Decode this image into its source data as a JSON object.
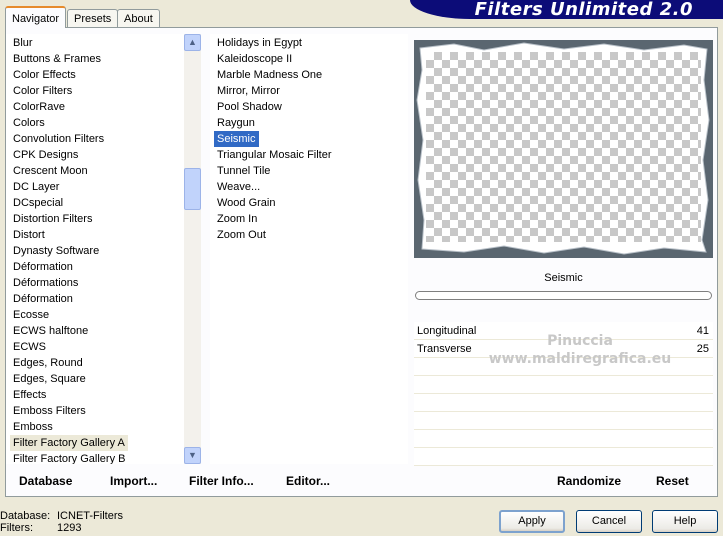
{
  "banner": {
    "title": "Filters Unlimited 2.0"
  },
  "tabs": [
    {
      "label": "Navigator",
      "active": true
    },
    {
      "label": "Presets",
      "active": false
    },
    {
      "label": "About",
      "active": false
    }
  ],
  "categories": {
    "items": [
      "Blur",
      "Buttons & Frames",
      "Color Effects",
      "Color Filters",
      "ColorRave",
      "Colors",
      "Convolution Filters",
      "CPK Designs",
      "Crescent Moon",
      "DC Layer",
      "DCspecial",
      "Distortion Filters",
      "Distort",
      "Dynasty Software",
      "Déformation",
      "Déformations",
      "Déformation",
      "Ecosse",
      "ECWS halftone",
      "ECWS",
      "Edges, Round",
      "Edges, Square",
      "Effects",
      "Emboss Filters",
      "Emboss",
      "Filter Factory Gallery A",
      "Filter Factory Gallery B"
    ],
    "highlighted_index": 25
  },
  "filters": {
    "items": [
      "Holidays in Egypt",
      "Kaleidoscope II",
      "Marble Madness One",
      "Mirror, Mirror",
      "Pool Shadow",
      "Raygun",
      "Seismic",
      "Triangular Mosaic Filter",
      "Tunnel Tile",
      "Weave...",
      "Wood Grain",
      "Zoom In",
      "Zoom Out"
    ],
    "selected_index": 6
  },
  "bottom_bar": {
    "database": "Database",
    "import": "Import...",
    "filter_info": "Filter Info...",
    "editor": "Editor...",
    "randomize": "Randomize",
    "reset": "Reset"
  },
  "preview": {
    "filter_name": "Seismic"
  },
  "params": [
    {
      "label": "Longitudinal",
      "value": "41"
    },
    {
      "label": "Transverse",
      "value": "25"
    }
  ],
  "watermark": {
    "line1": "Pinuccia",
    "line2": "www.maldiregrafica.eu"
  },
  "status": {
    "database_label": "Database:",
    "database_value": "ICNET-Filters",
    "filters_label": "Filters:",
    "filters_value": "1293"
  },
  "dialog_buttons": {
    "apply": "Apply",
    "cancel": "Cancel",
    "help": "Help"
  }
}
